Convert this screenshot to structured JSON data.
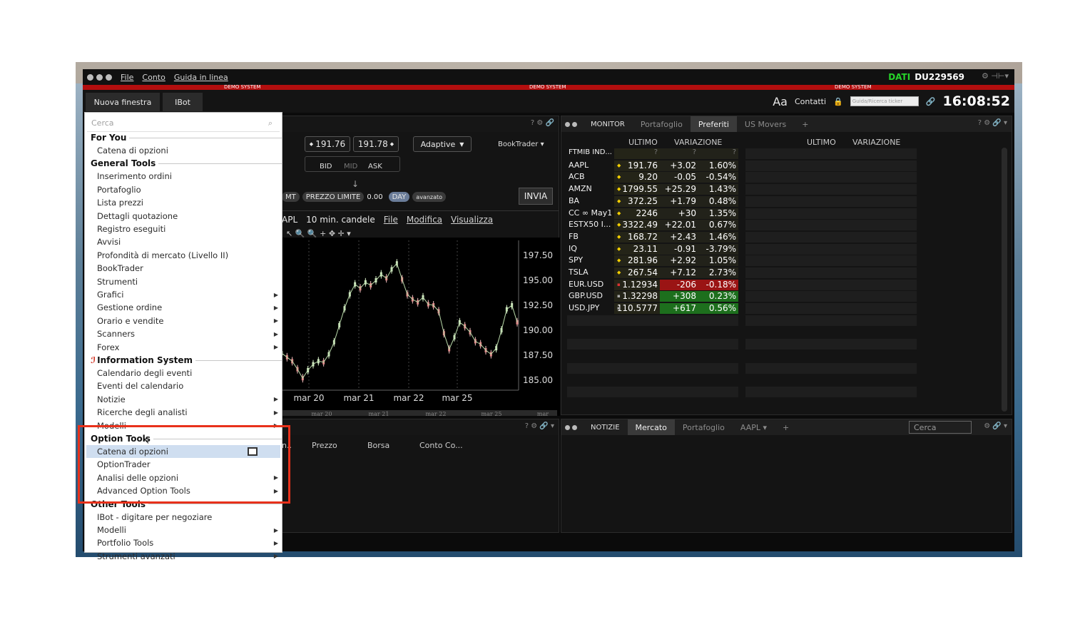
{
  "titlebar": {
    "menus": [
      "File",
      "Conto",
      "Guida in linea"
    ],
    "dati_label": "DATI",
    "account": "DU229569"
  },
  "demo_banner": "DEMO SYSTEM",
  "toolbar": {
    "new_window": "Nuova finestra",
    "ibot": "IBot",
    "font_label": "Aa",
    "contacts": "Contatti",
    "search_placeholder": "Guida/Ricerca ticker",
    "clock": "16:08:52"
  },
  "order_entry": {
    "bid_price": "191.76",
    "ask_price": "191.78",
    "bid_label": "BID",
    "mid_label": "MID",
    "ask_label": "ASK",
    "algo": "Adaptive",
    "booktrader": "BookTrader",
    "order_type_prefix": "MT",
    "order_type": "PREZZO LIMITE",
    "limit_price": "0.00",
    "tif": "DAY",
    "advanced": "avanzato",
    "send": "INVIA"
  },
  "chart": {
    "symbol": "APL",
    "interval": "10 min. candele",
    "menu": [
      "File",
      "Modifica",
      "Visualizza"
    ],
    "y_ticks": [
      "197.50",
      "195.00",
      "192.50",
      "190.00",
      "187.50",
      "185.00"
    ],
    "x_ticks": [
      "mar 20",
      "mar 21",
      "mar 22",
      "mar 25"
    ],
    "mini_x_ticks": [
      "mar 20",
      "mar 21",
      "mar 22",
      "mar 25",
      "mar"
    ]
  },
  "chart_data": {
    "type": "line",
    "title": "",
    "xlabel": "",
    "ylabel": "",
    "categories": [
      "mar 20",
      "mar 21",
      "mar 22",
      "mar 25"
    ],
    "ylim": [
      184,
      199
    ],
    "series": [
      {
        "values": [
          187.7,
          187.3,
          186.9,
          186.1,
          185.2,
          186.0,
          186.6,
          186.9,
          186.8,
          187.6,
          188.8,
          190.5,
          192.2,
          193.6,
          194.6,
          194.2,
          194.8,
          194.5,
          195.0,
          195.6,
          195.2,
          196.1,
          196.7,
          195.1,
          193.6,
          193.1,
          192.8,
          193.3,
          192.6,
          192.5,
          191.9,
          189.7,
          188.1,
          189.3,
          190.8,
          190.4,
          189.8,
          188.9,
          188.6,
          188.0,
          187.6,
          188.2,
          190.0,
          192.1,
          192.5,
          190.8
        ]
      }
    ]
  },
  "monitor": {
    "title": "MONITOR",
    "tabs": [
      "Portafoglio",
      "Preferiti",
      "US Movers"
    ],
    "headers": [
      "ULTIMO",
      "VARIAZIONE"
    ],
    "rows": [
      {
        "sym": "FTMIB IND...",
        "last": "?",
        "chg": "?",
        "pct": "?"
      },
      {
        "sym": "AAPL",
        "last": "191.76",
        "chg": "+3.02",
        "pct": "1.60%"
      },
      {
        "sym": "ACB",
        "last": "9.20",
        "chg": "-0.05",
        "pct": "-0.54%"
      },
      {
        "sym": "AMZN",
        "last": "1799.55",
        "chg": "+25.29",
        "pct": "1.43%"
      },
      {
        "sym": "BA",
        "last": "372.25",
        "chg": "+1.79",
        "pct": "0.48%"
      },
      {
        "sym": "CC ∞ May1...",
        "last": "2246",
        "chg": "+30",
        "pct": "1.35%"
      },
      {
        "sym": "ESTX50 I...",
        "last": "3322.49",
        "chg": "+22.01",
        "pct": "0.67%"
      },
      {
        "sym": "FB",
        "last": "168.72",
        "chg": "+2.43",
        "pct": "1.46%"
      },
      {
        "sym": "IQ",
        "last": "23.11",
        "chg": "-0.91",
        "pct": "-3.79%"
      },
      {
        "sym": "SPY",
        "last": "281.96",
        "chg": "+2.92",
        "pct": "1.05%"
      },
      {
        "sym": "TSLA",
        "last": "267.54",
        "chg": "+7.12",
        "pct": "2.73%"
      },
      {
        "sym": "EUR.USD",
        "last": "1.12934",
        "chg": "-206",
        "pct": "-0.18%"
      },
      {
        "sym": "GBP.USD",
        "last": "1.32298",
        "chg": "+308",
        "pct": "0.23%"
      },
      {
        "sym": "USD.JPY",
        "last": "110.5777",
        "chg": "+617",
        "pct": "0.56%"
      }
    ]
  },
  "news": {
    "title": "NOTIZIE",
    "tabs": [
      "Mercato",
      "Portafoglio",
      "AAPL"
    ],
    "search": "Cerca"
  },
  "lower_left": {
    "cols": [
      "n..",
      "Prezzo",
      "Borsa",
      "Conto  Co..."
    ]
  },
  "menu": {
    "search": "Cerca",
    "sections": {
      "for_you": "For You",
      "general": "General Tools",
      "info": "Information System",
      "option": "Option Tools",
      "other": "Other Tools"
    },
    "for_you_items": [
      "Catena di opzioni"
    ],
    "general_items": [
      "Inserimento ordini",
      "Portafoglio",
      "Lista prezzi",
      "Dettagli quotazione",
      "Registro eseguiti",
      "Avvisi",
      "Profondità di mercato (Livello II)",
      "BookTrader",
      "Strumenti",
      "Grafici",
      "Gestione ordine",
      "Orario e vendite",
      "Scanners",
      "Forex"
    ],
    "info_items": [
      "Calendario degli eventi",
      "Eventi del calendario",
      "Notizie",
      "Ricerche degli analisti",
      "Modelli"
    ],
    "option_items": [
      "Catena di opzioni",
      "OptionTrader",
      "Analisi delle opzioni",
      "Advanced Option Tools"
    ],
    "other_items": [
      "IBot - digitare per negoziare",
      "Modelli",
      "Portfolio Tools",
      "Strumenti avanzati"
    ]
  }
}
